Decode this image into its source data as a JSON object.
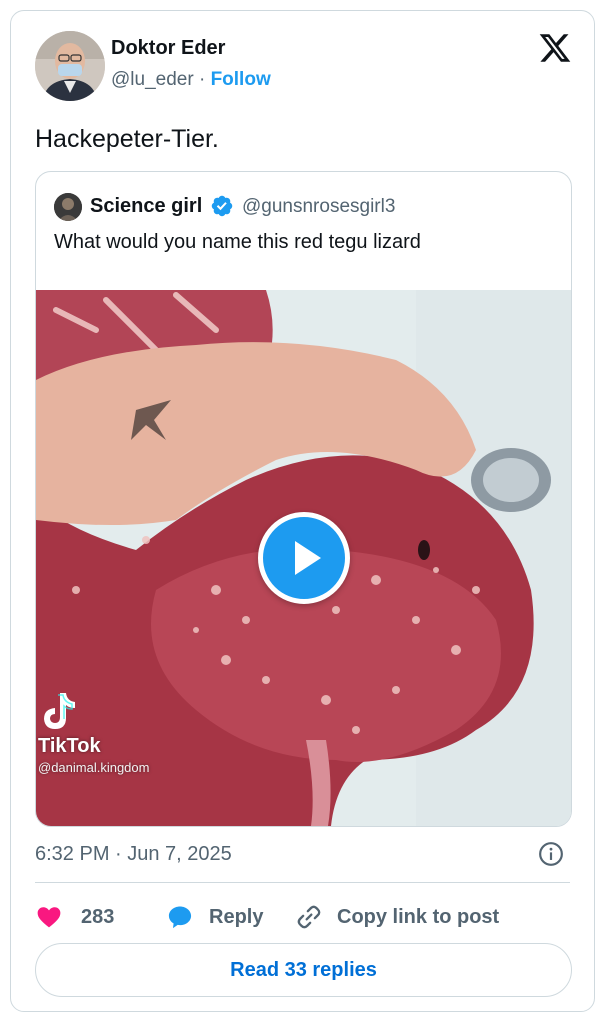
{
  "author": {
    "name": "Doktor Eder",
    "handle": "@lu_eder",
    "separator": "·",
    "follow_label": "Follow"
  },
  "tweet": {
    "text": "Hackepeter-Tier.",
    "timestamp": "6:32 PM · Jun 7, 2025"
  },
  "quoted": {
    "name": "Science girl",
    "handle": "@gunsnrosesgirl3",
    "text": "What would you name this red tegu lizard",
    "verified": true,
    "media": {
      "watermark_brand": "TikTok",
      "watermark_user": "@danimal.kingdom"
    }
  },
  "actions": {
    "like_count": "283",
    "reply_label": "Reply",
    "copy_link_label": "Copy link to post"
  },
  "read_replies_label": "Read 33 replies",
  "colors": {
    "accent": "#1d9bf0",
    "like": "#f91880",
    "text": "#0f1419",
    "muted": "#536471",
    "border": "#cfd9de"
  },
  "icons": [
    "x-logo-icon",
    "verified-badge-icon",
    "play-icon",
    "tiktok-logo-icon",
    "info-icon",
    "heart-icon",
    "reply-bubble-icon",
    "link-icon"
  ]
}
